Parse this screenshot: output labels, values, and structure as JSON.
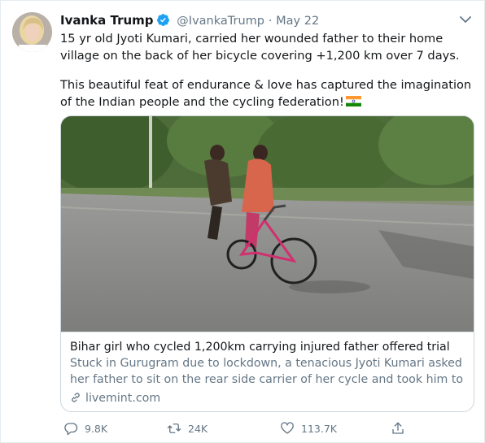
{
  "tweet": {
    "name": "Ivanka Trump",
    "handle": "@IvankaTrump",
    "separator": "·",
    "date": "May 22",
    "text_line1": "15 yr old Jyoti Kumari, carried her wounded father to their home village on the back of her bicycle covering +1,200 km over 7 days.",
    "text_line2": "This beautiful feat of endurance & love has captured the imagination of the Indian people and the cycling federation!",
    "icons": {
      "verified": "verified-badge-icon",
      "more": "chevron-down-icon",
      "flag": "india-flag-emoji",
      "link": "link-icon",
      "reply": "reply-icon",
      "retweet": "retweet-icon",
      "like": "heart-icon",
      "share": "share-icon"
    }
  },
  "card": {
    "title": "Bihar girl who cycled 1,200km carrying injured father offered trial",
    "description": "Stuck in Gurugram due to lockdown, a tenacious Jyoti Kumari asked her father to sit on the rear side carrier of her cycle and took him to his nati...",
    "domain": "livemint.com"
  },
  "actions": {
    "replies": "9.8K",
    "retweets": "24K",
    "likes": "113.7K"
  },
  "colors": {
    "accent": "#1da1f2",
    "muted": "#657786",
    "border": "#ccd6dd"
  }
}
